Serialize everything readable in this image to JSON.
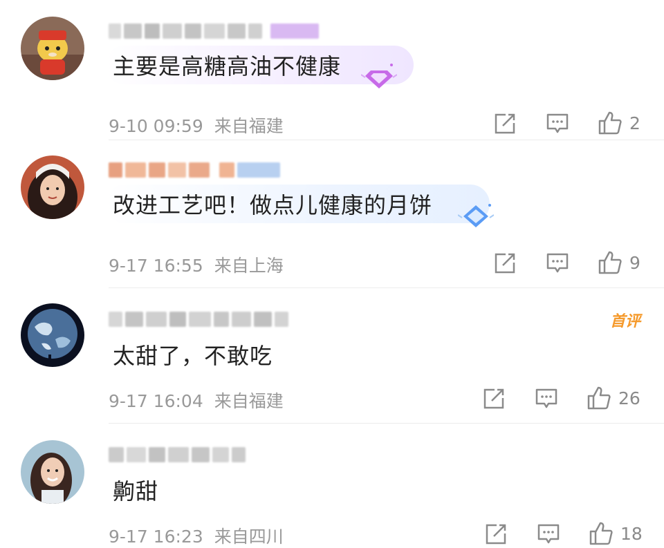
{
  "comments": [
    {
      "text": "主要是高糖高油不健康",
      "time": "9-10 09:59",
      "location": "来自福建",
      "likes": "2",
      "first_tag": "",
      "bubble_color": "#f7f0ff",
      "badge_color": "#c76ae8",
      "avatar_icon": "tiger-mascot-avatar"
    },
    {
      "text": "改进工艺吧！做点儿健康的月饼",
      "time": "9-17 16:55",
      "location": "来自上海",
      "likes": "9",
      "first_tag": "",
      "bubble_color": "#eef5ff",
      "badge_color": "#5b9cf5",
      "avatar_icon": "woman-portrait-avatar"
    },
    {
      "text": "太甜了，不敢吃",
      "time": "9-17 16:04",
      "location": "来自福建",
      "likes": "26",
      "first_tag": "首评",
      "avatar_icon": "earth-night-avatar"
    },
    {
      "text": "齁甜",
      "time": "9-17 16:23",
      "location": "来自四川",
      "likes": "18",
      "first_tag": "",
      "avatar_icon": "woman-smiling-avatar"
    }
  ],
  "icons": {
    "share": "share-icon",
    "reply": "comment-icon",
    "like": "thumbs-up-icon"
  }
}
